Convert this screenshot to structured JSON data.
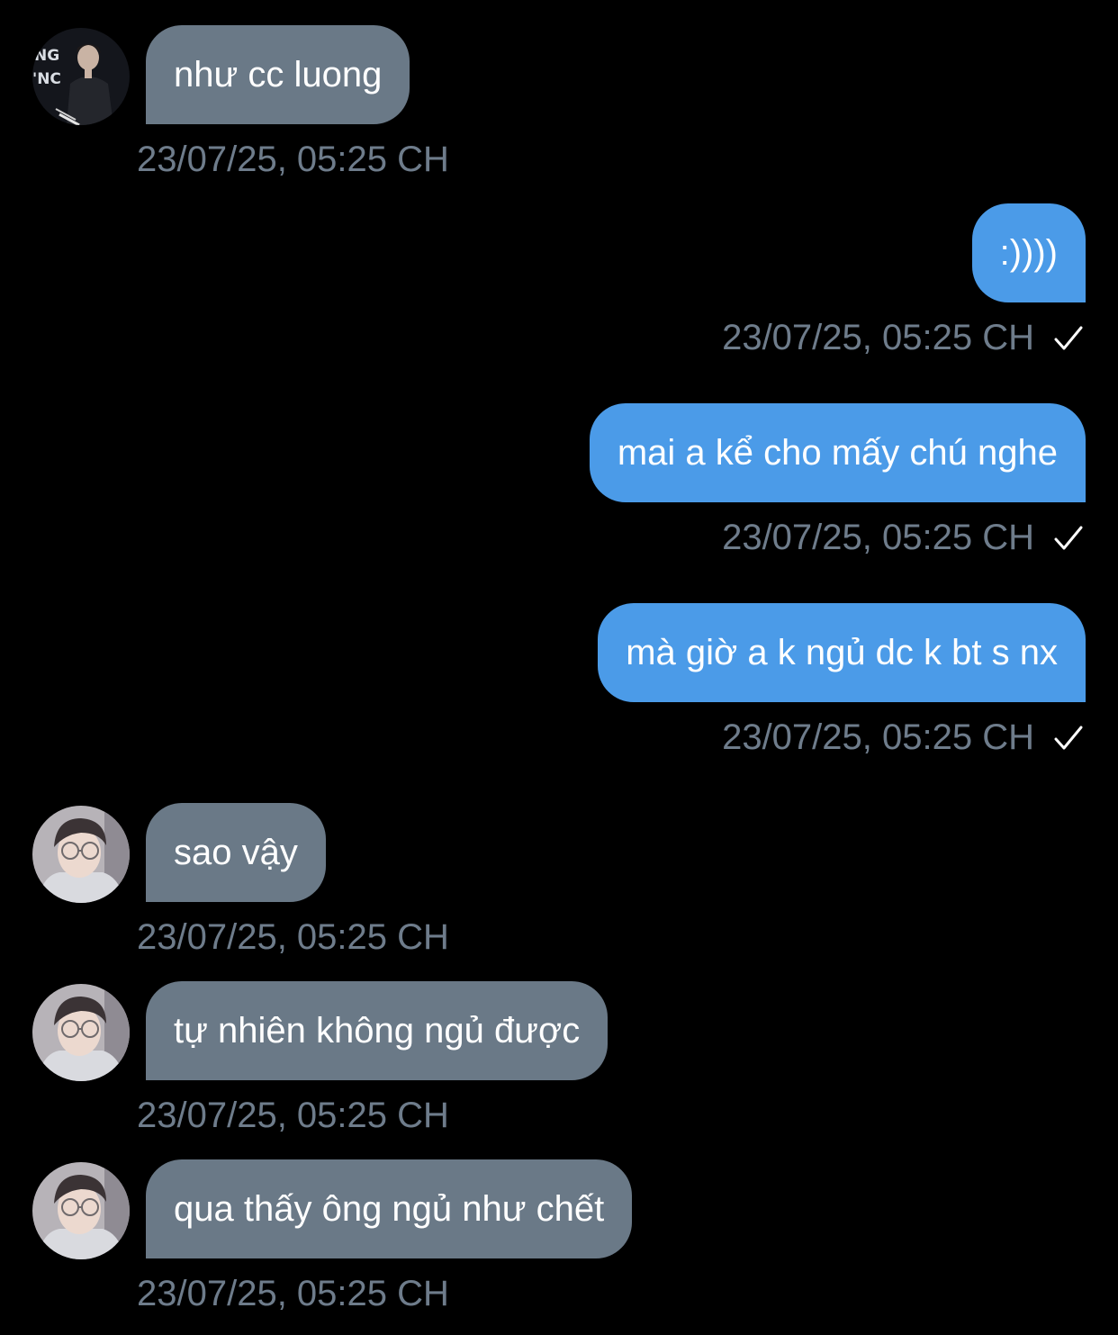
{
  "colors": {
    "background": "#000000",
    "incoming_bubble": "#6a7987",
    "outgoing_bubble": "#4b9be8",
    "timestamp": "#6e7c8b",
    "text": "#ffffff"
  },
  "messages": [
    {
      "direction": "incoming",
      "avatar": "avatar-performer",
      "text": "như cc luong",
      "time": "23/07/25, 05:25 CH"
    },
    {
      "direction": "outgoing",
      "text": ":))))",
      "time": "23/07/25, 05:25 CH",
      "status_icon": "check-icon"
    },
    {
      "direction": "outgoing",
      "text": "mai a kể cho mấy chú nghe",
      "time": "23/07/25, 05:25 CH",
      "status_icon": "check-icon"
    },
    {
      "direction": "outgoing",
      "text": "mà giờ a k ngủ dc k bt s nx",
      "time": "23/07/25, 05:25 CH",
      "status_icon": "check-icon"
    },
    {
      "direction": "incoming",
      "avatar": "avatar-glasses",
      "text": "sao vậy",
      "time": "23/07/25, 05:25 CH"
    },
    {
      "direction": "incoming",
      "avatar": "avatar-glasses",
      "text": "tự nhiên không ngủ được",
      "time": "23/07/25, 05:25 CH"
    },
    {
      "direction": "incoming",
      "avatar": "avatar-glasses",
      "text": "qua thấy ông ngủ như chết",
      "time": "23/07/25, 05:25 CH"
    }
  ]
}
